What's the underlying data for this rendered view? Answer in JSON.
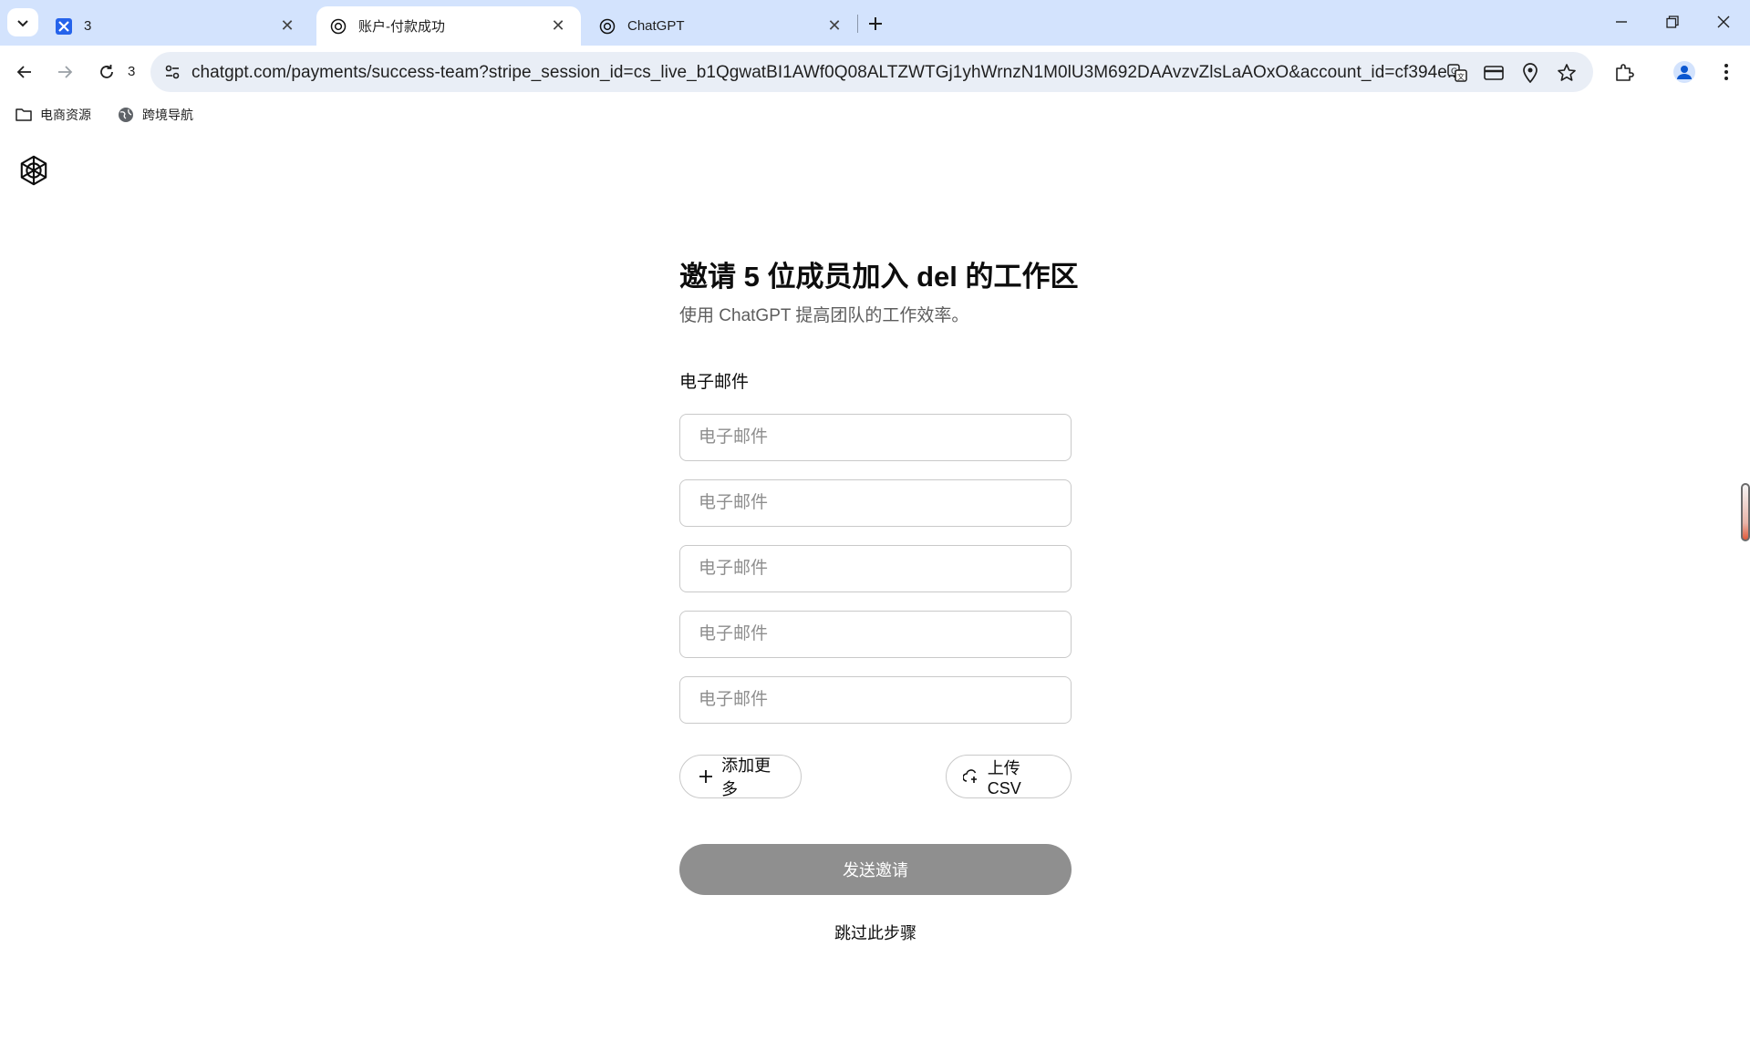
{
  "browser": {
    "tabs": [
      {
        "title": "3",
        "favicon": "blue-app-icon"
      },
      {
        "title": "账户-付款成功",
        "favicon": "openai-logo-icon"
      },
      {
        "title": "ChatGPT",
        "favicon": "openai-logo-icon"
      }
    ],
    "reload_count": "3",
    "url": "chatgpt.com/payments/success-team?stripe_session_id=cs_live_b1QgwatBI1AWf0Q08ALTZWTGj1yhWrnzN1M0lU3M692DAAvzvZlsLaAOxO&account_id=cf394e...",
    "bookmarks": [
      {
        "label": "电商资源",
        "icon": "folder-icon"
      },
      {
        "label": "跨境导航",
        "icon": "globe-icon"
      }
    ]
  },
  "page": {
    "title": "邀请 5 位成员加入 del 的工作区",
    "subtitle": "使用 ChatGPT 提高团队的工作效率。",
    "email_label": "电子邮件",
    "email_placeholder": "电子邮件",
    "add_more_label": "添加更多",
    "upload_csv_label": "上传 CSV",
    "send_button_label": "发送邀请",
    "skip_label": "跳过此步骤",
    "send_button_color": "#8f8f8f"
  }
}
